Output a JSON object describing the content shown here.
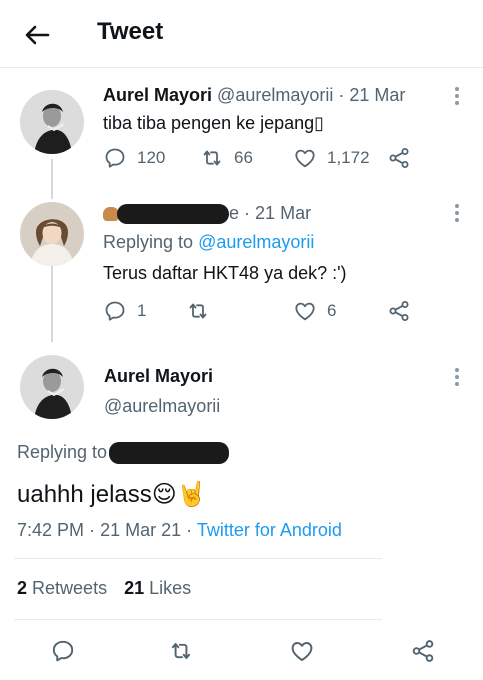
{
  "header": {
    "title": "Tweet"
  },
  "tweet1": {
    "name": "Aurel Mayori",
    "handle": "@aurelmayorii",
    "separator": "·",
    "date": "21 Mar",
    "text": "tiba tiba pengen ke jepang▯",
    "reply_count": "120",
    "retweet_count": "66",
    "like_count": "1,172"
  },
  "tweet2": {
    "name_tail": "e",
    "separator": "·",
    "date": "21 Mar",
    "replying_label": "Replying to",
    "replying_handle": "@aurelmayorii",
    "text": "Terus daftar HKT48 ya dek? :')",
    "reply_count": "1",
    "like_count": "6"
  },
  "main_tweet": {
    "name": "Aurel Mayori",
    "handle": "@aurelmayorii",
    "replying_label": "Replying to",
    "text": "uahhh jelass",
    "emoji1": "😌",
    "emoji2": "🤘",
    "time": "7:42 PM",
    "separator": "·",
    "date": "21 Mar 21",
    "separator2": "·",
    "source": "Twitter for Android",
    "retweets_count": "2",
    "retweets_label": "Retweets",
    "likes_count": "21",
    "likes_label": "Likes"
  },
  "icons": {
    "back": "arrow-left-icon",
    "reply": "reply-icon",
    "retweet": "retweet-icon",
    "like": "heart-icon",
    "share": "share-icon",
    "more": "more-vertical-icon"
  },
  "colors": {
    "accent": "#1d9bf0",
    "muted": "#536471",
    "text": "#0f1419",
    "border": "#e6ecf0"
  }
}
